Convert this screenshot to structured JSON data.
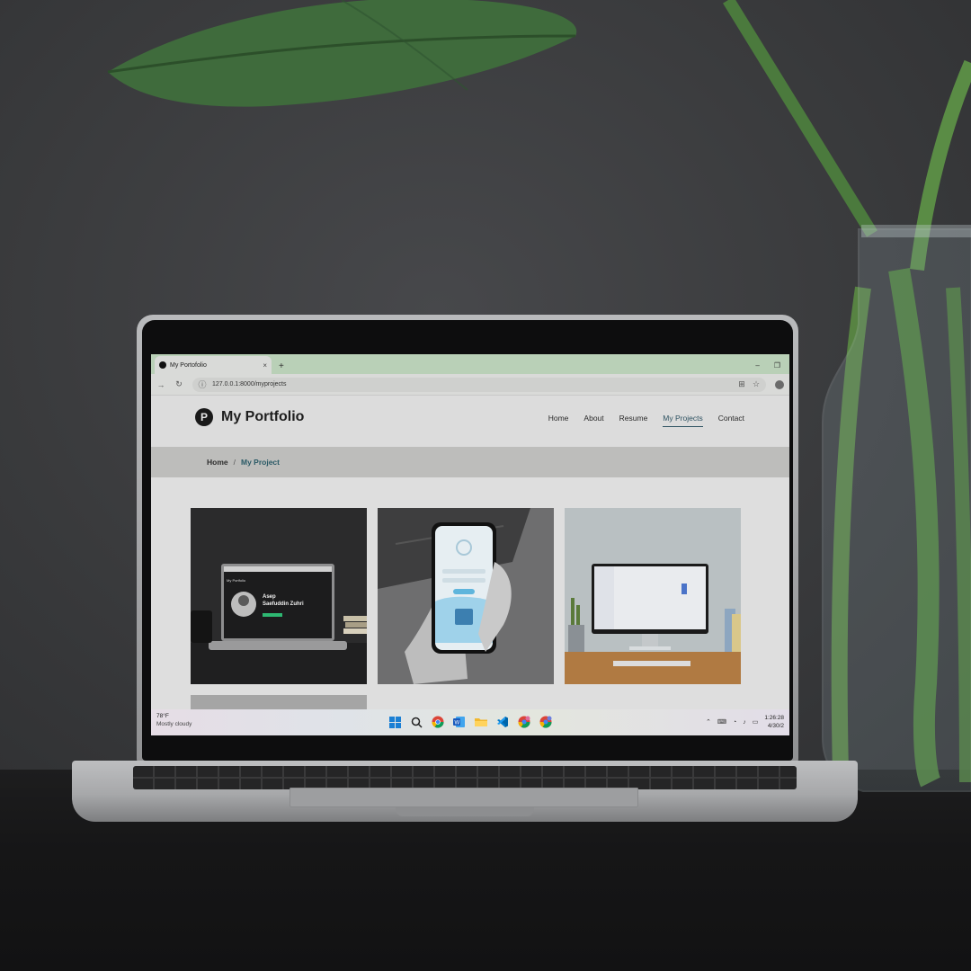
{
  "browser": {
    "tab_title": "My Portofolio",
    "new_tab_glyph": "+",
    "close_glyph": "×",
    "minimize_glyph": "–",
    "restore_glyph": "❐",
    "url": "127.0.0.1:8000/myprojects"
  },
  "site": {
    "logo_letter": "P",
    "title": "My Portfolio",
    "nav": [
      {
        "label": "Home"
      },
      {
        "label": "About"
      },
      {
        "label": "Resume"
      },
      {
        "label": "My Projects",
        "active": true
      },
      {
        "label": "Contact"
      }
    ],
    "breadcrumb": {
      "home": "Home",
      "separator": "/",
      "current": "My Project"
    },
    "project_card_1": {
      "name_line1": "Asep",
      "name_line2": "Saefuddin Zuhri",
      "screen_title": "My Portfolio"
    }
  },
  "taskbar": {
    "weather_temp": "78°F",
    "weather_desc": "Mostly cloudy",
    "time": "1:26:28",
    "date": "4/30/2",
    "apps": [
      "windows-start-icon",
      "search-icon",
      "chrome-icon",
      "word-icon",
      "file-explorer-icon",
      "vscode-icon",
      "chrome-profile-icon",
      "chrome-profile-2-icon"
    ]
  },
  "colors": {
    "tab_bar": "#b9d0b7",
    "nav_active": "#2e5261",
    "breadcrumb_current": "#2a5a66"
  }
}
